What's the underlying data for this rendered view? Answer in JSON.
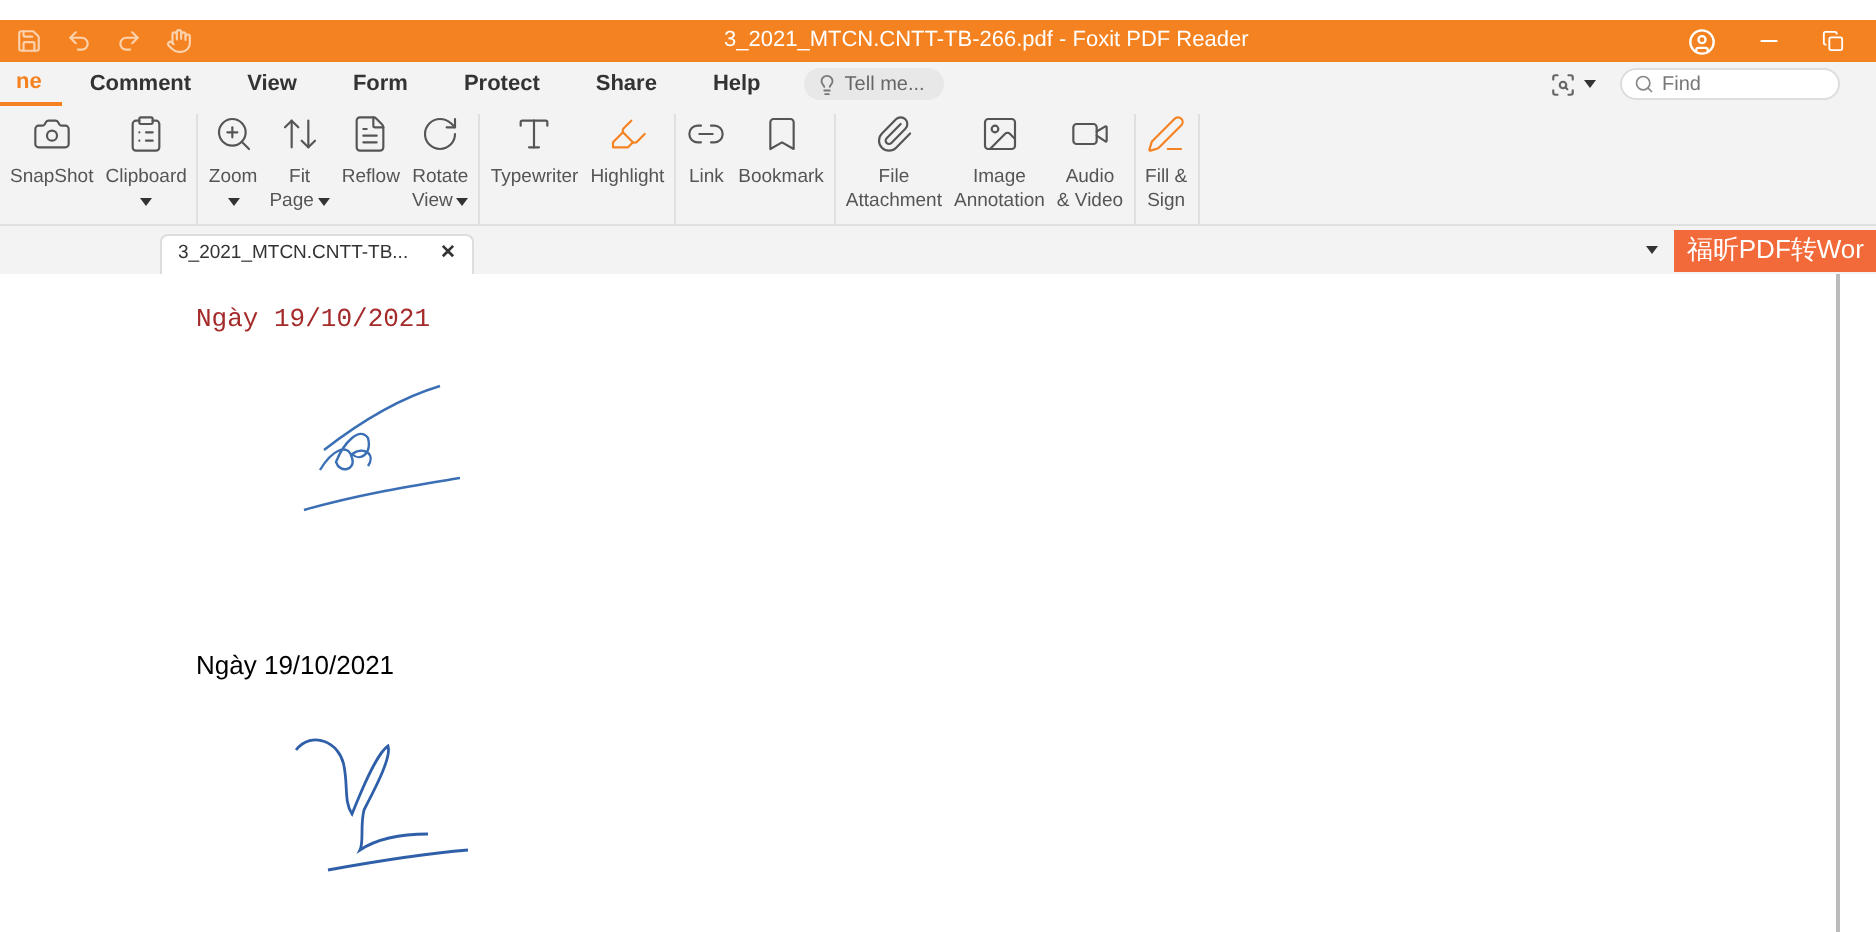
{
  "window": {
    "title": "3_2021_MTCN.CNTT-TB-266.pdf - Foxit PDF Reader"
  },
  "menu": [
    {
      "label": "ne",
      "selected": true
    },
    {
      "label": "Comment",
      "selected": false
    },
    {
      "label": "View",
      "selected": false
    },
    {
      "label": "Form",
      "selected": false
    },
    {
      "label": "Protect",
      "selected": false
    },
    {
      "label": "Share",
      "selected": false
    },
    {
      "label": "Help",
      "selected": false
    }
  ],
  "tell_me": {
    "placeholder": "Tell me..."
  },
  "find": {
    "placeholder": "Find"
  },
  "ribbon": [
    [
      {
        "lines": [
          "SnapShot"
        ],
        "dropdown": false
      },
      {
        "lines": [
          "Clipboard"
        ],
        "dropdown": true
      }
    ],
    [
      {
        "lines": [
          "Zoom"
        ],
        "dropdown": true
      },
      {
        "lines": [
          "Fit",
          "Page"
        ],
        "dropdown": true
      },
      {
        "lines": [
          "Reflow"
        ],
        "dropdown": false
      },
      {
        "lines": [
          "Rotate",
          "View"
        ],
        "dropdown": true
      }
    ],
    [
      {
        "lines": [
          "Typewriter"
        ],
        "dropdown": false
      },
      {
        "lines": [
          "Highlight"
        ],
        "dropdown": false
      }
    ],
    [
      {
        "lines": [
          "Link"
        ],
        "dropdown": false
      },
      {
        "lines": [
          "Bookmark"
        ],
        "dropdown": false
      }
    ],
    [
      {
        "lines": [
          "File",
          "Attachment"
        ],
        "dropdown": false
      },
      {
        "lines": [
          "Image",
          "Annotation"
        ],
        "dropdown": false
      },
      {
        "lines": [
          "Audio",
          "& Video"
        ],
        "dropdown": false
      }
    ],
    [
      {
        "lines": [
          "Fill &",
          "Sign"
        ],
        "dropdown": false
      }
    ]
  ],
  "doc_tab": {
    "label": "3_2021_MTCN.CNTT-TB...",
    "close": "✕"
  },
  "promo": "福昕PDF转Wor",
  "document": [
    {
      "date": "Ngày 19/10/2021",
      "kind": "mono"
    },
    {
      "date": "Ngày 19/10/2021",
      "kind": "sans"
    }
  ]
}
